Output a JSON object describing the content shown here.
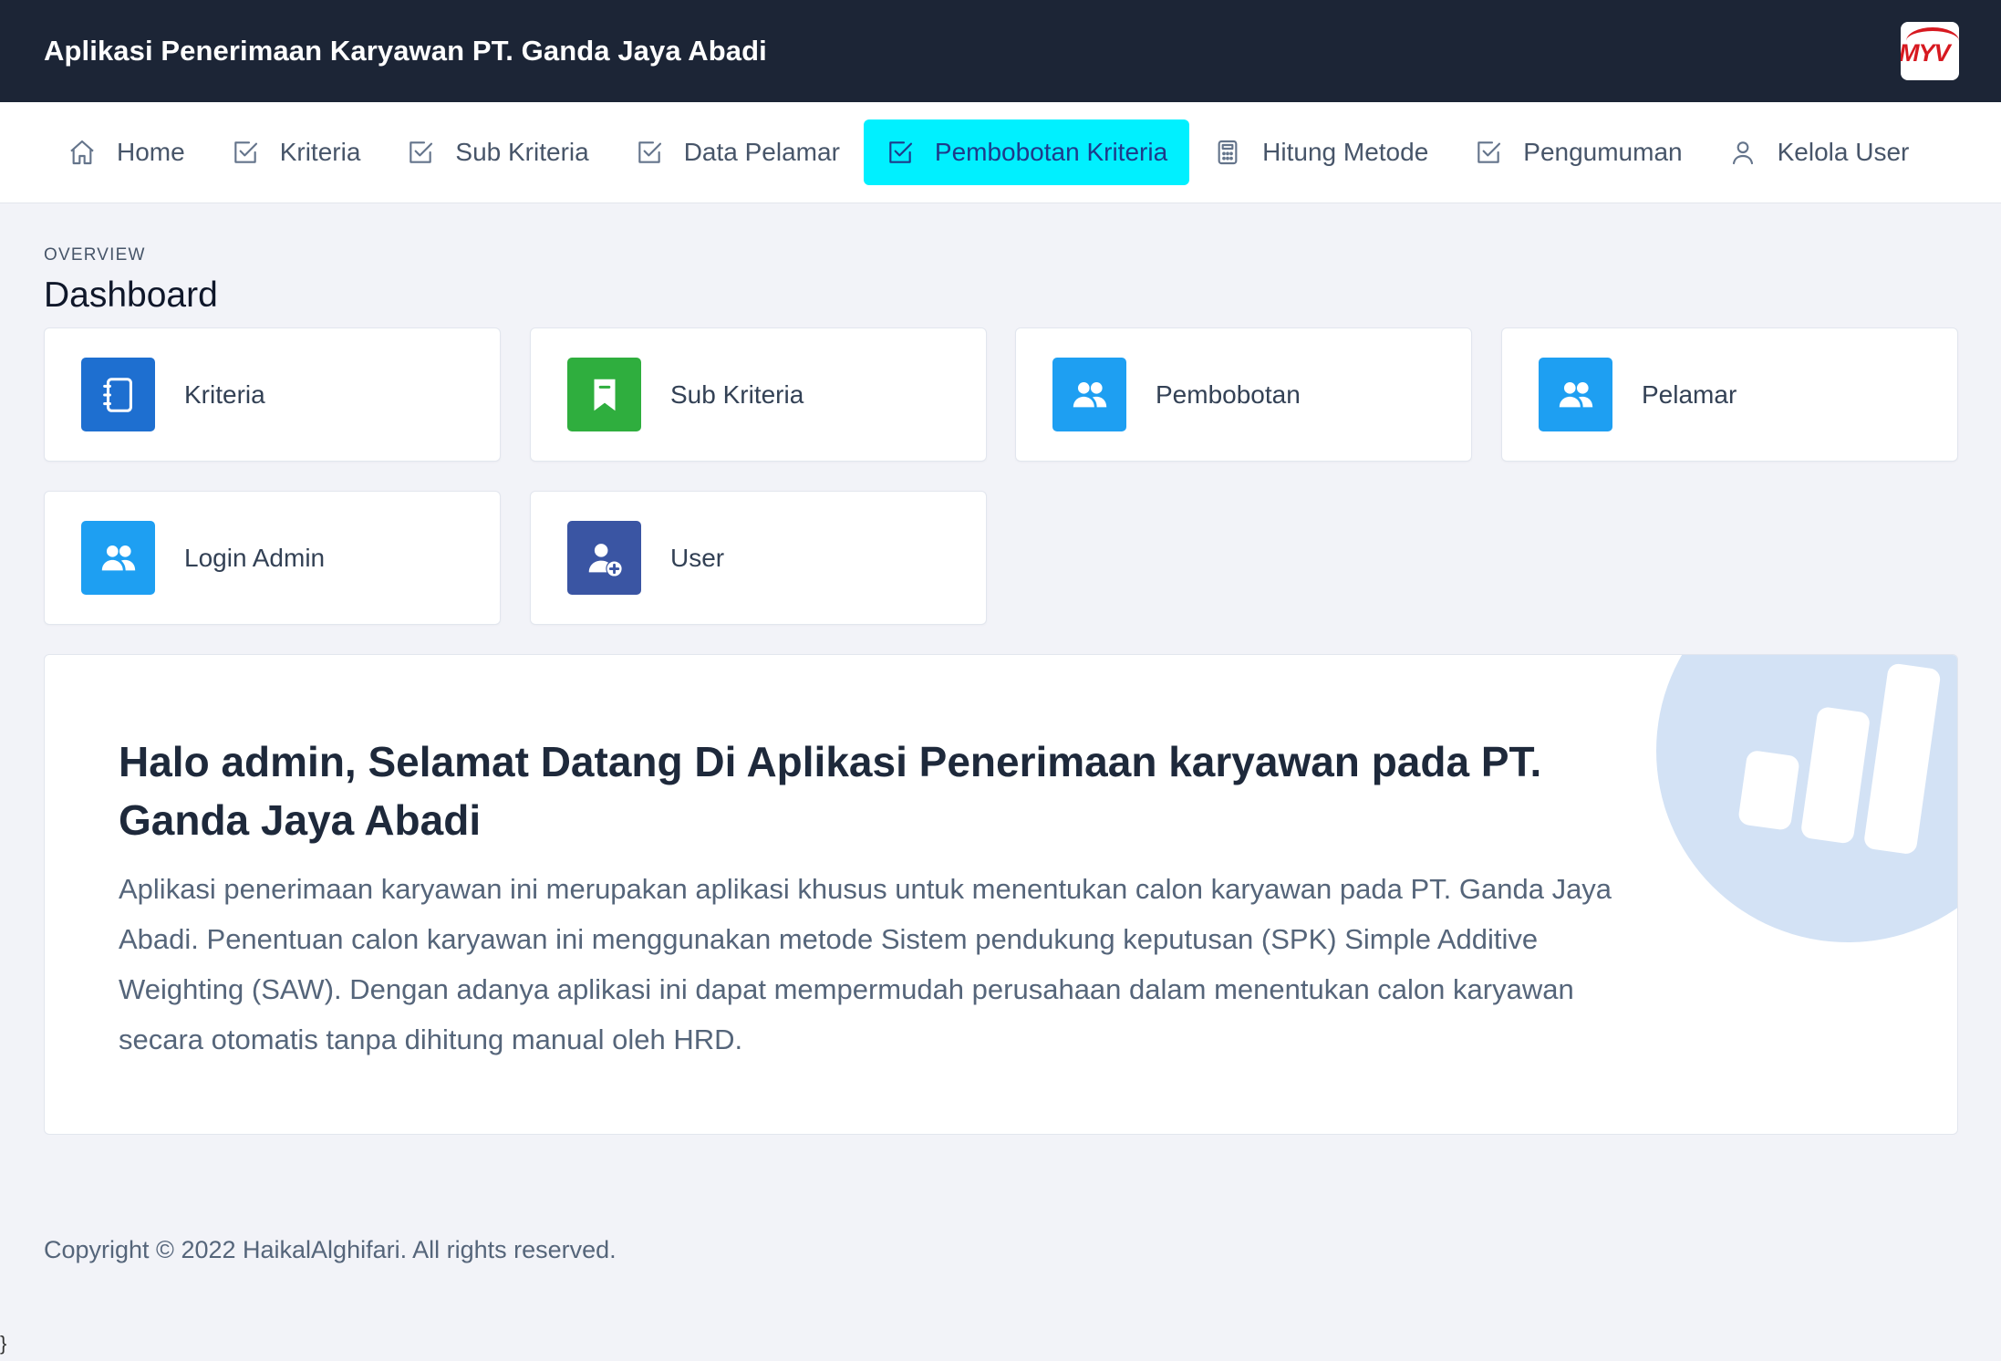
{
  "header": {
    "app_title": "Aplikasi Penerimaan Karyawan PT. Ganda Jaya Abadi",
    "avatar_logo_text": "MYV"
  },
  "nav": {
    "items": [
      {
        "label": "Home",
        "icon": "home-icon",
        "active": false
      },
      {
        "label": "Kriteria",
        "icon": "checkbox-icon",
        "active": false
      },
      {
        "label": "Sub Kriteria",
        "icon": "checkbox-icon",
        "active": false
      },
      {
        "label": "Data Pelamar",
        "icon": "checkbox-icon",
        "active": false
      },
      {
        "label": "Pembobotan Kriteria",
        "icon": "checkbox-icon",
        "active": true
      },
      {
        "label": "Hitung Metode",
        "icon": "calculator-icon",
        "active": false
      },
      {
        "label": "Pengumuman",
        "icon": "checkbox-icon",
        "active": false
      },
      {
        "label": "Kelola User",
        "icon": "user-icon",
        "active": false
      }
    ],
    "active_color": "#00f0ff"
  },
  "page": {
    "overline": "OVERVIEW",
    "title": "Dashboard"
  },
  "cards": [
    {
      "label": "Kriteria",
      "icon": "notebook-icon",
      "color": "#1e6fd0"
    },
    {
      "label": "Sub Kriteria",
      "icon": "bookmark-icon",
      "color": "#2fae3e"
    },
    {
      "label": "Pembobotan",
      "icon": "users-icon",
      "color": "#1e9ff2"
    },
    {
      "label": "Pelamar",
      "icon": "users-icon",
      "color": "#1e9ff2"
    },
    {
      "label": "Login Admin",
      "icon": "users-icon",
      "color": "#1e9ff2"
    },
    {
      "label": "User",
      "icon": "user-add-icon",
      "color": "#3a55a3"
    }
  ],
  "welcome": {
    "heading": "Halo admin, Selamat Datang Di Aplikasi Penerimaan karyawan pada PT. Ganda Jaya Abadi",
    "description": "Aplikasi penerimaan karyawan ini merupakan aplikasi khusus untuk menentukan calon karyawan pada PT. Ganda Jaya Abadi. Penentuan calon karyawan ini menggunakan metode Sistem pendukung keputusan (SPK) Simple Additive Weighting (SAW). Dengan adanya aplikasi ini dapat mempermudah perusahaan dalam menentukan calon karyawan secara otomatis tanpa dihitung manual oleh HRD.",
    "decoration_icon": "bar-chart-icon"
  },
  "footer": {
    "copyright": "Copyright © 2022 HaikalAlghifari. All rights reserved."
  },
  "stray_text": "}"
}
